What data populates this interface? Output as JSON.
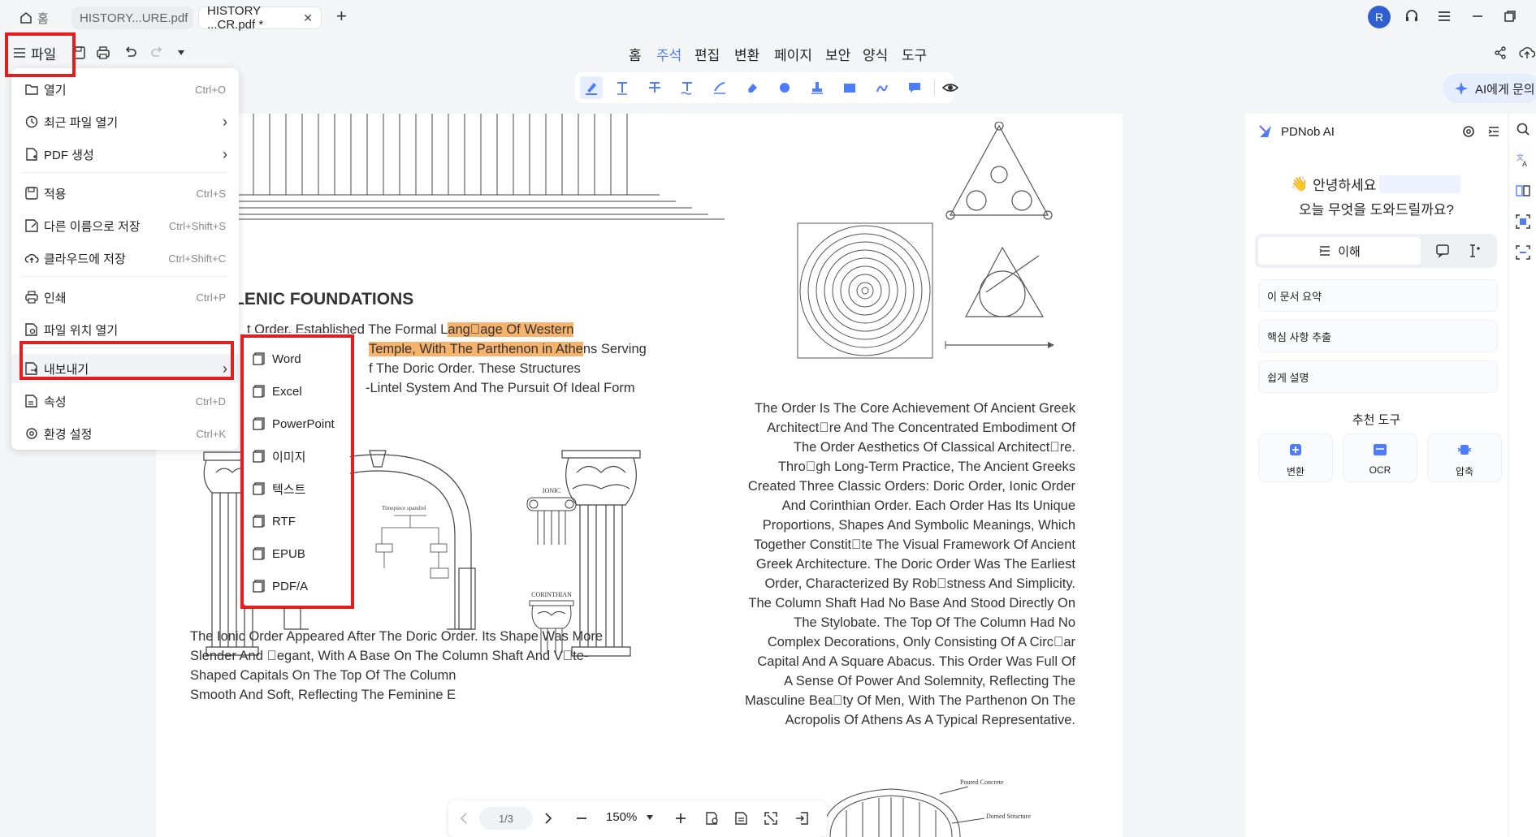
{
  "tabs": {
    "home_label": "홈",
    "tab1": "HISTORY...URE.pdf",
    "tab2": "HISTORY ...CR.pdf *",
    "close": "✕",
    "new": "+"
  },
  "window": {
    "avatar_letter": "R"
  },
  "file_button": {
    "label": "파일"
  },
  "main_menu": [
    "홈",
    "주석",
    "편집",
    "변환",
    "페이지",
    "보안",
    "양식",
    "도구"
  ],
  "ask_ai": {
    "label": "AI에게 문의"
  },
  "file_menu": {
    "items": [
      {
        "label": "열기",
        "shortcut": "Ctrl+O"
      },
      {
        "label": "최근 파일 열기",
        "shortcut": ""
      },
      {
        "label": "PDF 생성",
        "shortcut": ""
      },
      {
        "label": "적용",
        "shortcut": "Ctrl+S"
      },
      {
        "label": "다른 이름으로 저장",
        "shortcut": "Ctrl+Shift+S"
      },
      {
        "label": "클라우드에 저장",
        "shortcut": "Ctrl+Shift+C"
      },
      {
        "label": "인쇄",
        "shortcut": "Ctrl+P"
      },
      {
        "label": "파일 위치 열기",
        "shortcut": ""
      },
      {
        "label": "내보내기",
        "shortcut": ""
      },
      {
        "label": "속성",
        "shortcut": "Ctrl+D"
      },
      {
        "label": "환경 설정",
        "shortcut": "Ctrl+K"
      }
    ]
  },
  "export_menu": [
    "Word",
    "Excel",
    "PowerPoint",
    "이미지",
    "텍스트",
    "RTF",
    "EPUB",
    "PDF/A"
  ],
  "ai_panel": {
    "title": "PDNob AI",
    "greeting": "안녕하세요",
    "question": "오늘 무엇을 도와드릴까요?",
    "tab_understand": "이해",
    "chips": [
      "이 문서 요약",
      "핵심 사항 추출",
      "쉽게 설명"
    ],
    "recommended_title": "추천 도구",
    "tools": [
      "변환",
      "OCR",
      "압축"
    ]
  },
  "bottom_bar": {
    "page": "1/3",
    "zoom": "150%"
  },
  "document": {
    "heading": "LENIC FOUNDATIONS",
    "para1_line1_a": "t Order. Established The Formal L",
    "para1_line1_hl": "ang\u0000age Of Western",
    "para1_line2_hl": "Temple, With The Parthenon in Athe",
    "para1_line2_b": "ns Serving",
    "para1_line3": "f The Doric Order. These Structures",
    "para1_line4": "-Lintel System And The Pursuit Of Ideal Form",
    "right_col": [
      "The Order Is The Core Achievement Of Ancient Greek",
      "Architect\u0000re And The Concentrated Embodiment Of",
      "The Order Aesthetics Of Classical Architect\u0000re.",
      "Thro\u0000gh Long-Term Practice, The Ancient Greeks",
      "Created Three Classic Orders: Doric Order, Ionic Order",
      "And Corinthian Order. Each Order Has Its Unique",
      "Proportions, Shapes And Symbolic Meanings, Which",
      "Together Constit\u0000te The Visual Framework Of Ancient",
      "Greek Architecture. The Doric Order Was The Earliest",
      "Order, Characterized By Rob\u0000stness And Simplicity.",
      "The Column Shaft Had No Base And Stood Directly On",
      "The Stylobate. The Top Of The Column Had No",
      "Complex Decorations, Only Consisting Of A Circ\u0000ar",
      "Capital And A Square Abacus. This Order Was Full Of",
      "A Sense Of Power And Solemnity, Reflecting The",
      "Masculine Bea\u0000ty Of Men, With The Parthenon On The",
      "Acropolis Of Athens As A Typical Representative."
    ],
    "bottom_lines": [
      "The Ionic Order Appeared After The Doric Order. Its Shape Was More",
      "Slender And \u0000egant, With A Base On The Column Shaft And V\u0000te-",
      "Shaped Capitals On The Top Of The Column",
      "Smooth And Soft, Reflecting The Feminine E"
    ],
    "fig_ionic": "IONIC",
    "fig_corinthian": "CORINTHIAN",
    "fig_arch_label": "Timepiece spandrel",
    "fig_dome_1": "Poured Concrete",
    "fig_dome_2": "Domed Structure"
  }
}
